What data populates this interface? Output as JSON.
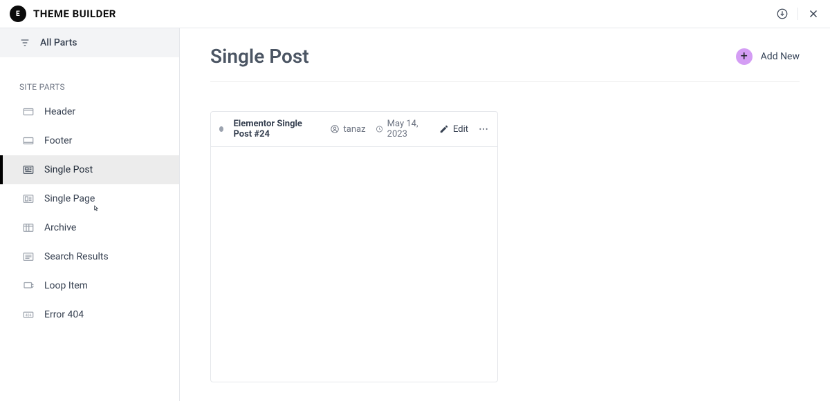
{
  "header": {
    "app_title": "THEME BUILDER",
    "logo_text": "E"
  },
  "sidebar": {
    "all_parts": "All Parts",
    "section_title": "SITE PARTS",
    "items": [
      {
        "label": "Header"
      },
      {
        "label": "Footer"
      },
      {
        "label": "Single Post"
      },
      {
        "label": "Single Page"
      },
      {
        "label": "Archive"
      },
      {
        "label": "Search Results"
      },
      {
        "label": "Loop Item"
      },
      {
        "label": "Error 404"
      }
    ]
  },
  "main": {
    "title": "Single Post",
    "add_new_label": "Add New",
    "cards": [
      {
        "title": "Elementor Single Post #24",
        "author": "tanaz",
        "date": "May 14, 2023",
        "edit_label": "Edit"
      }
    ]
  }
}
